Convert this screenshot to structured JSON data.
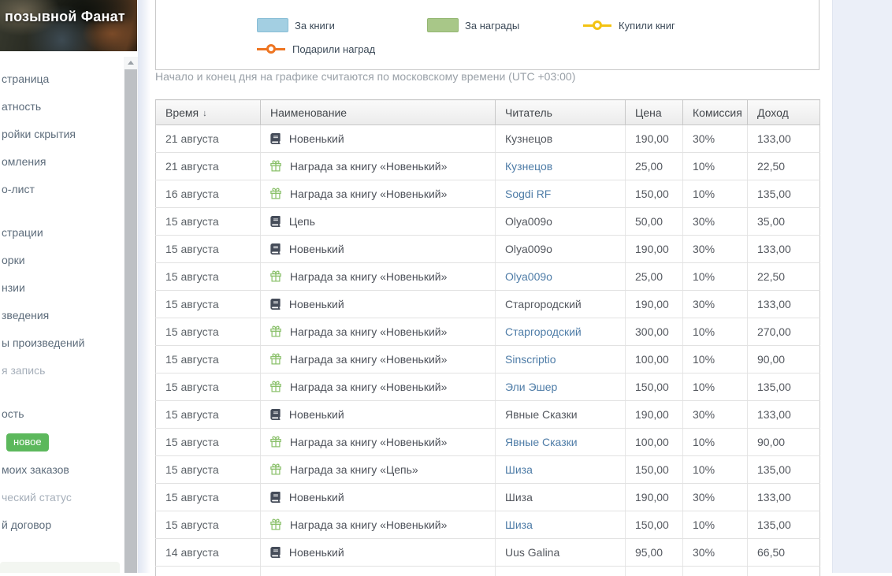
{
  "banner": {
    "title": "позывной Фанат"
  },
  "sidebar": {
    "badge_color": "#5cb85c",
    "sections": [
      {
        "items": [
          {
            "label": "страница"
          },
          {
            "label": "атность"
          },
          {
            "label": "ройки скрытия"
          },
          {
            "label": "омления"
          },
          {
            "label": "о-лист"
          }
        ]
      },
      {
        "items": [
          {
            "label": "страции"
          },
          {
            "label": "орки"
          },
          {
            "label": "нзии"
          },
          {
            "label": "зведения"
          },
          {
            "label": "ы произведений"
          },
          {
            "label": "я запись",
            "muted": true
          }
        ]
      },
      {
        "items": [
          {
            "label": "ость"
          },
          {
            "label": "новое",
            "badge": true
          },
          {
            "label": "моих заказов"
          },
          {
            "label": "ческий статус",
            "muted": true
          },
          {
            "label": "й договор"
          }
        ]
      }
    ]
  },
  "chart": {
    "legend": [
      {
        "label": "За книги",
        "type": "swatch",
        "color": "#a3cfe2",
        "border": "#88bdd6"
      },
      {
        "label": "За награды",
        "type": "swatch",
        "color": "#a8c788",
        "border": "#93b671"
      },
      {
        "label": "Купили книг",
        "type": "line",
        "color": "#f3c312"
      },
      {
        "label": "Подарили наград",
        "type": "line",
        "color": "#ee7522"
      }
    ],
    "note": "Начало и конец дня на графике считаются по московскому времени (UTC +03:00)"
  },
  "table": {
    "columns": [
      {
        "label": "Время",
        "sorted": "desc"
      },
      {
        "label": "Наименование"
      },
      {
        "label": "Читатель"
      },
      {
        "label": "Цена"
      },
      {
        "label": "Комиссия"
      },
      {
        "label": "Доход"
      }
    ],
    "rows": [
      {
        "date": "21 августа",
        "icon": "book",
        "name": "Новенький",
        "reader": "Кузнецов",
        "reader_link": false,
        "price": "190,00",
        "commission": "30%",
        "income": "133,00"
      },
      {
        "date": "21 августа",
        "icon": "gift",
        "name": "Награда за книгу «Новенький»",
        "reader": "Кузнецов",
        "reader_link": true,
        "price": "25,00",
        "commission": "10%",
        "income": "22,50"
      },
      {
        "date": "16 августа",
        "icon": "gift",
        "name": "Награда за книгу «Новенький»",
        "reader": "Sogdi RF",
        "reader_link": true,
        "price": "150,00",
        "commission": "10%",
        "income": "135,00"
      },
      {
        "date": "15 августа",
        "icon": "book",
        "name": "Цепь",
        "reader": "Olya009o",
        "reader_link": false,
        "price": "50,00",
        "commission": "30%",
        "income": "35,00"
      },
      {
        "date": "15 августа",
        "icon": "book",
        "name": "Новенький",
        "reader": "Olya009o",
        "reader_link": false,
        "price": "190,00",
        "commission": "30%",
        "income": "133,00"
      },
      {
        "date": "15 августа",
        "icon": "gift",
        "name": "Награда за книгу «Новенький»",
        "reader": "Olya009o",
        "reader_link": true,
        "price": "25,00",
        "commission": "10%",
        "income": "22,50"
      },
      {
        "date": "15 августа",
        "icon": "book",
        "name": "Новенький",
        "reader": "Старгородский",
        "reader_link": false,
        "price": "190,00",
        "commission": "30%",
        "income": "133,00"
      },
      {
        "date": "15 августа",
        "icon": "gift",
        "name": "Награда за книгу «Новенький»",
        "reader": "Старгородский",
        "reader_link": true,
        "price": "300,00",
        "commission": "10%",
        "income": "270,00"
      },
      {
        "date": "15 августа",
        "icon": "gift",
        "name": "Награда за книгу «Новенький»",
        "reader": "Sinscriptio",
        "reader_link": true,
        "price": "100,00",
        "commission": "10%",
        "income": "90,00"
      },
      {
        "date": "15 августа",
        "icon": "gift",
        "name": "Награда за книгу «Новенький»",
        "reader": "Эли Эшер",
        "reader_link": true,
        "price": "150,00",
        "commission": "10%",
        "income": "135,00"
      },
      {
        "date": "15 августа",
        "icon": "book",
        "name": "Новенький",
        "reader": "Явные Сказки",
        "reader_link": false,
        "price": "190,00",
        "commission": "30%",
        "income": "133,00"
      },
      {
        "date": "15 августа",
        "icon": "gift",
        "name": "Награда за книгу «Новенький»",
        "reader": "Явные Сказки",
        "reader_link": true,
        "price": "100,00",
        "commission": "10%",
        "income": "90,00"
      },
      {
        "date": "15 августа",
        "icon": "gift",
        "name": "Награда за книгу «Цепь»",
        "reader": "Шиза",
        "reader_link": true,
        "price": "150,00",
        "commission": "10%",
        "income": "135,00"
      },
      {
        "date": "15 августа",
        "icon": "book",
        "name": "Новенький",
        "reader": "Шиза",
        "reader_link": false,
        "price": "190,00",
        "commission": "30%",
        "income": "133,00"
      },
      {
        "date": "15 августа",
        "icon": "gift",
        "name": "Награда за книгу «Новенький»",
        "reader": "Шиза",
        "reader_link": true,
        "price": "150,00",
        "commission": "10%",
        "income": "135,00"
      },
      {
        "date": "14 августа",
        "icon": "book",
        "name": "Новенький",
        "reader": "Uus Galina",
        "reader_link": false,
        "price": "95,00",
        "commission": "30%",
        "income": "66,50"
      }
    ]
  }
}
